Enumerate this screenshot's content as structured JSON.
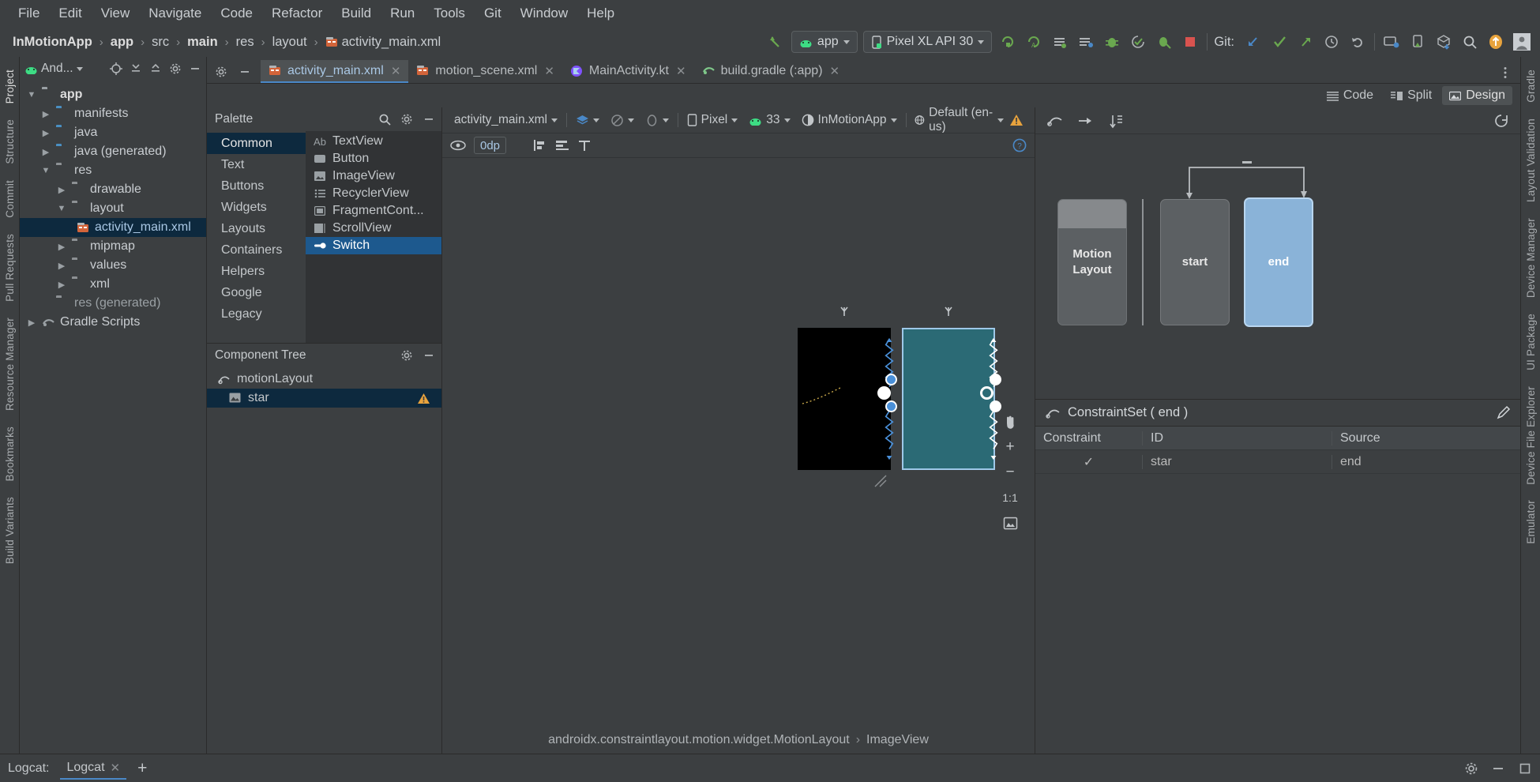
{
  "menubar": {
    "items": [
      {
        "label": "File"
      },
      {
        "label": "Edit"
      },
      {
        "label": "View"
      },
      {
        "label": "Navigate"
      },
      {
        "label": "Code"
      },
      {
        "label": "Refactor"
      },
      {
        "label": "Build"
      },
      {
        "label": "Run"
      },
      {
        "label": "Tools"
      },
      {
        "label": "Git"
      },
      {
        "label": "Window"
      },
      {
        "label": "Help"
      }
    ]
  },
  "toolbar": {
    "breadcrumb": [
      "InMotionApp",
      "app",
      "src",
      "main",
      "res",
      "layout",
      "activity_main.xml"
    ],
    "module_chip": "app",
    "device_chip": "Pixel XL API 30",
    "git_label": "Git:"
  },
  "project": {
    "selector_label": "And...",
    "tree": [
      {
        "label": "app",
        "depth": 0,
        "arrow": "down",
        "icon": "module-folder",
        "bold": true,
        "selected": false
      },
      {
        "label": "manifests",
        "depth": 1,
        "arrow": "right",
        "icon": "folder-blue",
        "bold": false,
        "selected": false
      },
      {
        "label": "java",
        "depth": 1,
        "arrow": "right",
        "icon": "folder-blue",
        "bold": false,
        "selected": false
      },
      {
        "label": "java (generated)",
        "depth": 1,
        "arrow": "right",
        "icon": "folder-blue-gen",
        "bold": false,
        "selected": false
      },
      {
        "label": "res",
        "depth": 1,
        "arrow": "down",
        "icon": "folder-res",
        "bold": false,
        "selected": false
      },
      {
        "label": "drawable",
        "depth": 2,
        "arrow": "right",
        "icon": "folder-gray",
        "bold": false,
        "selected": false
      },
      {
        "label": "layout",
        "depth": 2,
        "arrow": "down",
        "icon": "folder-gray",
        "bold": false,
        "selected": false
      },
      {
        "label": "activity_main.xml",
        "depth": 3,
        "arrow": "none",
        "icon": "layout-file",
        "bold": false,
        "selected": true
      },
      {
        "label": "mipmap",
        "depth": 2,
        "arrow": "right",
        "icon": "folder-gray",
        "bold": false,
        "selected": false
      },
      {
        "label": "values",
        "depth": 2,
        "arrow": "right",
        "icon": "folder-gray",
        "bold": false,
        "selected": false
      },
      {
        "label": "xml",
        "depth": 2,
        "arrow": "right",
        "icon": "folder-gray",
        "bold": false,
        "selected": false
      },
      {
        "label": "res (generated)",
        "depth": 1,
        "arrow": "none",
        "icon": "folder-gen",
        "bold": false,
        "selected": false,
        "dim": true
      },
      {
        "label": "Gradle Scripts",
        "depth": 0,
        "arrow": "right",
        "icon": "gradle-icon",
        "bold": false,
        "selected": false
      }
    ]
  },
  "left_strip": [
    {
      "label": "Project",
      "active": true
    },
    {
      "label": "Structure",
      "active": false
    },
    {
      "label": "Commit",
      "active": false
    },
    {
      "label": "Pull Requests",
      "active": false
    },
    {
      "label": "Resource Manager",
      "active": false
    },
    {
      "label": "Bookmarks",
      "active": false
    },
    {
      "label": "Build Variants",
      "active": false
    }
  ],
  "right_strip": [
    {
      "label": "Gradle"
    },
    {
      "label": "Layout Validation"
    },
    {
      "label": "Device Manager"
    },
    {
      "label": "UI Package"
    },
    {
      "label": "Device File Explorer"
    },
    {
      "label": "Emulator"
    }
  ],
  "tabs": [
    {
      "label": "activity_main.xml",
      "icon": "layout-file-icon",
      "active": true,
      "closable": true
    },
    {
      "label": "motion_scene.xml",
      "icon": "layout-file-icon",
      "active": false,
      "closable": true
    },
    {
      "label": "MainActivity.kt",
      "icon": "kotlin-icon",
      "active": false,
      "closable": true
    },
    {
      "label": "build.gradle (:app)",
      "icon": "gradle-icon",
      "active": false,
      "closable": true
    }
  ],
  "view_modes": [
    {
      "label": "Code",
      "active": false
    },
    {
      "label": "Split",
      "active": false
    },
    {
      "label": "Design",
      "active": true
    }
  ],
  "palette": {
    "title": "Palette",
    "categories": [
      {
        "label": "Common",
        "selected": true
      },
      {
        "label": "Text",
        "selected": false
      },
      {
        "label": "Buttons",
        "selected": false
      },
      {
        "label": "Widgets",
        "selected": false
      },
      {
        "label": "Layouts",
        "selected": false
      },
      {
        "label": "Containers",
        "selected": false
      },
      {
        "label": "Helpers",
        "selected": false
      },
      {
        "label": "Google",
        "selected": false
      },
      {
        "label": "Legacy",
        "selected": false
      }
    ],
    "items": [
      {
        "label": "TextView",
        "icon": "text-icon",
        "glyph": "Ab",
        "selected": false
      },
      {
        "label": "Button",
        "icon": "button-icon",
        "glyph": "▭",
        "selected": false
      },
      {
        "label": "ImageView",
        "icon": "image-icon",
        "glyph": "⛰",
        "selected": false
      },
      {
        "label": "RecyclerView",
        "icon": "list-icon",
        "glyph": "☰",
        "selected": false
      },
      {
        "label": "FragmentCont...",
        "icon": "fragment-icon",
        "glyph": "▣",
        "selected": false
      },
      {
        "label": "ScrollView",
        "icon": "scroll-icon",
        "glyph": "▤",
        "selected": false
      },
      {
        "label": "Switch",
        "icon": "switch-icon",
        "glyph": "⊸",
        "selected": true
      }
    ]
  },
  "component_tree": {
    "title": "Component Tree",
    "rows": [
      {
        "label": "motionLayout",
        "icon": "motion-layout-icon",
        "selected": false,
        "warning": false,
        "indent": false
      },
      {
        "label": "star",
        "icon": "image-view-icon",
        "selected": true,
        "warning": true,
        "indent": true
      }
    ]
  },
  "design_toolbar": {
    "file_chip": "activity_main.xml",
    "device_chip": "Pixel",
    "api_chip": "33",
    "theme_chip": "InMotionApp",
    "locale_chip": "Default (en-us)",
    "zoom_value": "0dp"
  },
  "motion_editor": {
    "states": [
      {
        "label": "Motion Layout",
        "kind": "motion-layout",
        "selected": false
      },
      {
        "label": "start",
        "kind": "constraint-set",
        "selected": false
      },
      {
        "label": "end",
        "kind": "constraint-set",
        "selected": true
      }
    ],
    "constraint_set": {
      "title": "ConstraintSet ( end )",
      "columns": [
        "Constraint",
        "ID",
        "Source"
      ],
      "rows": [
        {
          "constraint": "✓",
          "id": "star",
          "source": "end"
        }
      ]
    }
  },
  "status_breadcrumb": {
    "path": "androidx.constraintlayout.motion.widget.MotionLayout",
    "leaf": "ImageView"
  },
  "bottom_bar": {
    "label": "Logcat:",
    "tab": "Logcat",
    "add": "+"
  },
  "colors": {
    "accent_blue": "#4a88c7",
    "selection_blue": "#1d598e",
    "tree_selection": "#0d293e",
    "end_state": "#8ab3d8",
    "warning": "#e8a33d",
    "panel_bg": "#3c3f41",
    "list_bg": "#313335"
  }
}
